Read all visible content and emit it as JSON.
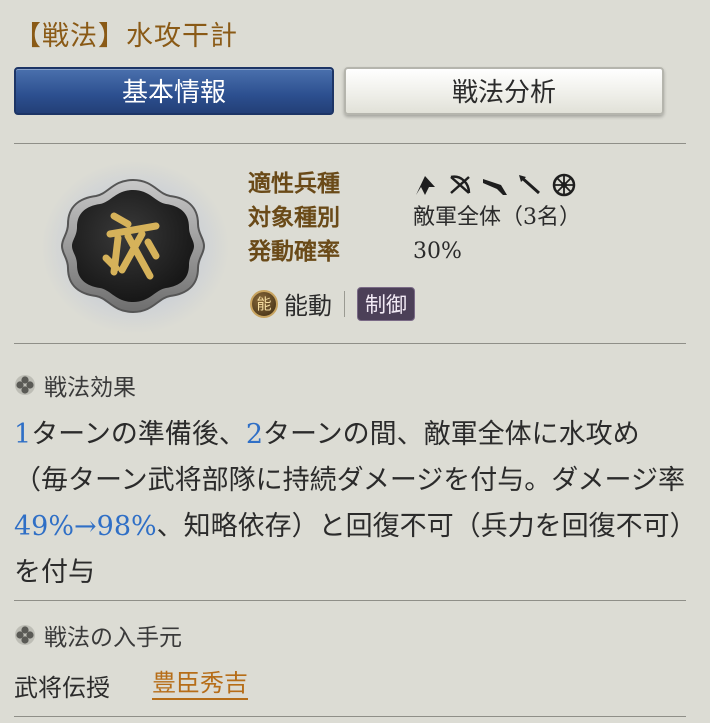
{
  "title": "【戦法】水攻干計",
  "tabs": [
    {
      "label": "基本情報",
      "active": true
    },
    {
      "label": "戦法分析",
      "active": false
    }
  ],
  "info": {
    "rows": [
      {
        "label": "適性兵種",
        "value": ""
      },
      {
        "label": "対象種別",
        "value": "敵軍全体（3名）"
      },
      {
        "label": "発動確率",
        "value": "30%"
      }
    ],
    "unit_icons": [
      "cavalry-icon",
      "archer-icon",
      "gun-icon",
      "spear-icon",
      "wheel-icon"
    ]
  },
  "tags": {
    "type_icon_text": "能",
    "type_label": "能動",
    "category": "制御"
  },
  "effect_section": {
    "heading": "戦法効果",
    "text_parts": [
      {
        "text": "1",
        "highlight": true
      },
      {
        "text": "ターンの準備後、",
        "highlight": false
      },
      {
        "text": "2",
        "highlight": true
      },
      {
        "text": "ターンの間、敵軍全体に水攻め（毎ターン武将部隊に持続ダメージを付与。ダメージ率",
        "highlight": false
      },
      {
        "text": "49%→98%",
        "highlight": true
      },
      {
        "text": "、知略依存）と回復不可（兵力を回復不可）を付与",
        "highlight": false
      }
    ]
  },
  "source_section": {
    "heading": "戦法の入手元",
    "label": "武将伝授",
    "link": "豊臣秀吉"
  },
  "colors": {
    "background": "#dcdcd4",
    "title": "#8a5a16",
    "active_tab": "#2c4f8f",
    "highlight_number": "#2f6fc6",
    "link": "#b66d18"
  }
}
